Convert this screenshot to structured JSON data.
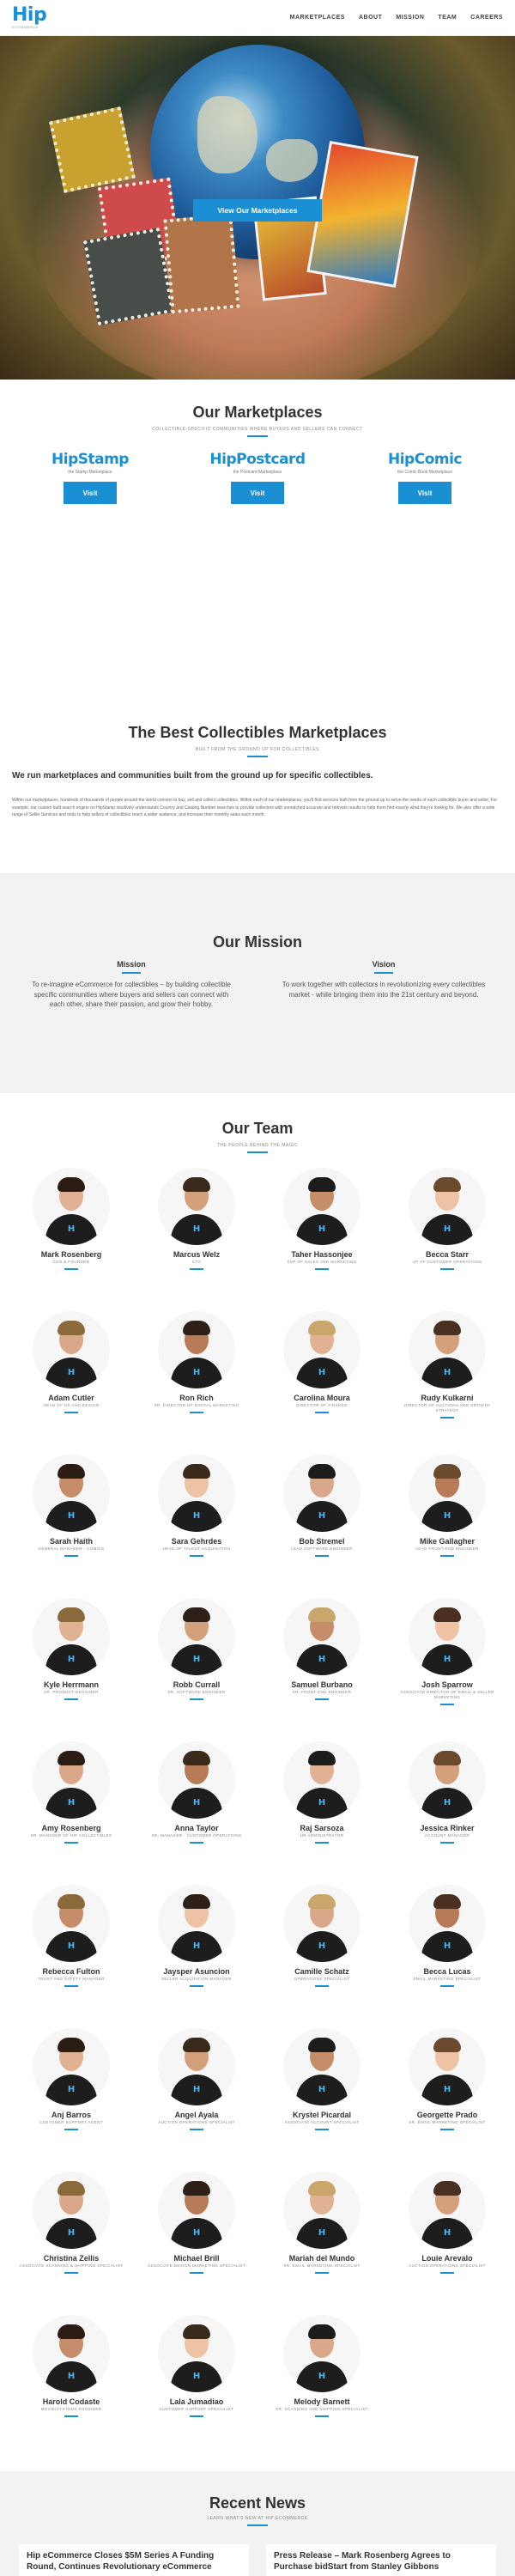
{
  "header": {
    "logo_text": "Hip",
    "logo_sub": "ECOMMERCE",
    "nav": [
      "MARKETPLACES",
      "ABOUT",
      "MISSION",
      "TEAM",
      "CAREERS"
    ]
  },
  "hero": {
    "button_label": "View Our Marketplaces"
  },
  "marketplaces": {
    "title": "Our Marketplaces",
    "subtitle": "COLLECTIBLE-SPECIFIC COMMUNITIES WHERE BUYERS AND SELLERS CAN CONNECT",
    "items": [
      {
        "logo": "HipStamp",
        "desc": "the Stamp Marketplace",
        "button": "Visit"
      },
      {
        "logo": "HipPostcard",
        "desc": "the Postcard Marketplace",
        "button": "Visit"
      },
      {
        "logo": "HipComic",
        "desc": "the Comic Book Marketplace",
        "button": "Visit"
      }
    ]
  },
  "best": {
    "title": "The Best Collectibles Marketplaces",
    "subtitle": "BUILT FROM THE GROUND UP FOR COLLECTIBLES",
    "lead": "We run marketplaces and communities built from the ground up for specific collectibles.",
    "body": "Within our marketplaces, hundreds of thousands of people around the world connect to buy, sell and collect collectibles. Within each of our marketplaces, you'll find services built from the ground up to serve the needs of each collectible buyer and seller. For example, our custom built search engine on HipStamp intuitively understands Country and Catalog Number searches to provide collectors with unmatched accurate and relevant results to help them find exactly what they're looking for. We also offer a wide range of Seller Services and tools to help sellers of collectibles reach a wider audience, and increase their monthly sales each month."
  },
  "mission": {
    "title": "Our Mission",
    "mission_title": "Mission",
    "mission_text": "To re-imagine eCommerce for collectibles – by building collectible specific communities where buyers and sellers can connect with each other, share their passion, and grow their hobby.",
    "vision_title": "Vision",
    "vision_text": "To work together with collectors in revolutionizing every collectibles market - while bringing them into the 21st century and beyond."
  },
  "team": {
    "title": "Our Team",
    "subtitle": "THE PEOPLE BEHIND THE MAGIC",
    "members": [
      {
        "name": "Mark Rosenberg",
        "role": "CEO & FOUNDER"
      },
      {
        "name": "Marcus Welz",
        "role": "CTO"
      },
      {
        "name": "Taher Hassonjee",
        "role": "SVP OF SALES AND MARKETING"
      },
      {
        "name": "Becca Starr",
        "role": "VP OF CUSTOMER OPERATIONS"
      },
      {
        "name": "Adam Cutler",
        "role": "HEAD OF UX AND DESIGN"
      },
      {
        "name": "Ron Rich",
        "role": "SR. DIRECTOR OF DIGITAL MARKETING"
      },
      {
        "name": "Carolina Moura",
        "role": "DIRECTOR OF FINANCE"
      },
      {
        "name": "Rudy Kulkarni",
        "role": "DIRECTOR OF AUCTIONS AND GROWTH STRATEGY"
      },
      {
        "name": "Sarah Haith",
        "role": "GENERAL MANAGER - COMICS"
      },
      {
        "name": "Sara Gehrdes",
        "role": "HEAD OF TALENT ACQUISITION"
      },
      {
        "name": "Bob Stremel",
        "role": "LEAD SOFTWARE ENGINEER"
      },
      {
        "name": "Mike Gallagher",
        "role": "LEAD FRONT-END ENGINEER"
      },
      {
        "name": "Kyle Herrmann",
        "role": "SR. PRODUCT DESIGNER"
      },
      {
        "name": "Robb Currall",
        "role": "SR. SOFTWARE ENGINEER"
      },
      {
        "name": "Samuel Burbano",
        "role": "SR. FRONT-END ENGINEER"
      },
      {
        "name": "Josh Sparrow",
        "role": "ASSOCIATE DIRECTOR OF EMAIL & SELLER MARKETING"
      },
      {
        "name": "Amy Rosenberg",
        "role": "SR. MANAGER OF HIP COLLECTIBLES"
      },
      {
        "name": "Anna Taylor",
        "role": "SR. MANAGER - CUSTOMER OPERATIONS"
      },
      {
        "name": "Raj Sarsoza",
        "role": "HR ADMINISTRATOR"
      },
      {
        "name": "Jessica Rinker",
        "role": "ACCOUNT MANAGER"
      },
      {
        "name": "Rebecca Fulton",
        "role": "TRUST AND SAFETY MANAGER"
      },
      {
        "name": "Jaysper Asuncion",
        "role": "SELLER ACQUISITION MANAGER"
      },
      {
        "name": "Camille Schatz",
        "role": "OPERATIONS SPECIALIST"
      },
      {
        "name": "Becca Lucas",
        "role": "EMAIL MARKETING SPECIALIST"
      },
      {
        "name": "Anj Barros",
        "role": "CUSTOMER SUPPORT AGENT"
      },
      {
        "name": "Angel Ayala",
        "role": "AUCTION OPERATIONS SPECIALIST"
      },
      {
        "name": "Krystel Picardal",
        "role": "ASSOCIATE ACCOUNT SPECIALIST"
      },
      {
        "name": "Georgette Prado",
        "role": "SR. EMAIL MARKETING SPECIALIST"
      },
      {
        "name": "Christina Zellis",
        "role": "ASSOCIATE SCANNING & SHIPPING SPECIALIST"
      },
      {
        "name": "Michael Brill",
        "role": "ASSOCIATE DESIGN MARKETING SPECIALIST"
      },
      {
        "name": "Mariah del Mundo",
        "role": "SR. EMAIL MARKETING SPECIALIST"
      },
      {
        "name": "Louie Arevalo",
        "role": "AUCTION OPERATIONS SPECIALIST"
      },
      {
        "name": "Harold Codaste",
        "role": "MOVIE/SYSTEMS ENGINEER"
      },
      {
        "name": "Lala Jumadiao",
        "role": "CUSTOMER SUPPORT SPECIALIST"
      },
      {
        "name": "Melody Barnett",
        "role": "SR. SCANNING AND SHIPPING SPECIALIST"
      }
    ]
  },
  "news": {
    "title": "Recent News",
    "subtitle": "LEARN WHAT'S NEW AT HIP ECOMMERCE",
    "items": [
      {
        "title": "Hip eCommerce Closes $5M Series A Funding Round, Continues Revolutionary eCommerce"
      },
      {
        "title": "Press Release – Mark Rosenberg Agrees to Purchase bidStart from Stanley Gibbons"
      }
    ]
  },
  "colors": {
    "accent": "#1a8fd3",
    "mission_bg": "#f2f2f2",
    "text": "#333333"
  }
}
